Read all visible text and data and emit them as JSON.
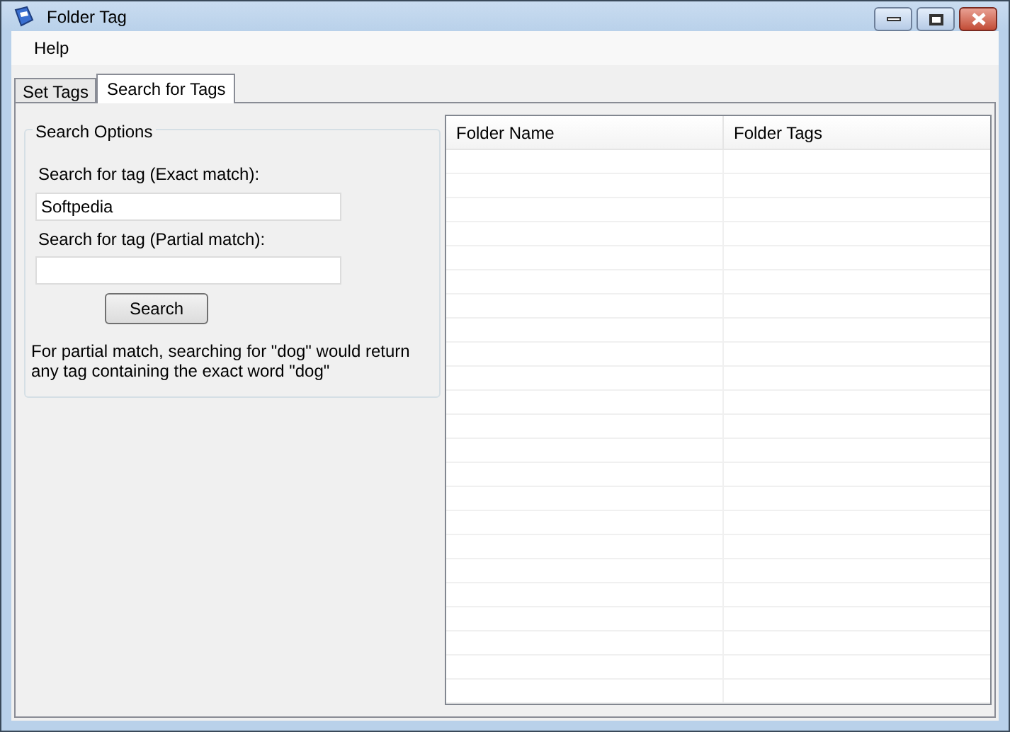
{
  "window": {
    "title": "Folder Tag"
  },
  "menu": [
    "Help"
  ],
  "tabs": [
    {
      "label": "Set Tags",
      "selected": false
    },
    {
      "label": "Search for Tags",
      "selected": true
    }
  ],
  "search_options": {
    "title": "Search Options",
    "exact_label": "Search for tag (Exact match):",
    "exact_value": "Softpedia",
    "partial_label": "Search for tag (Partial match):",
    "button": "Search",
    "note": "For partial match, searching for \"dog\" would return any tag containing the exact word \"dog\""
  },
  "table": {
    "columns": [
      "Folder Name",
      "Folder Tags"
    ]
  }
}
